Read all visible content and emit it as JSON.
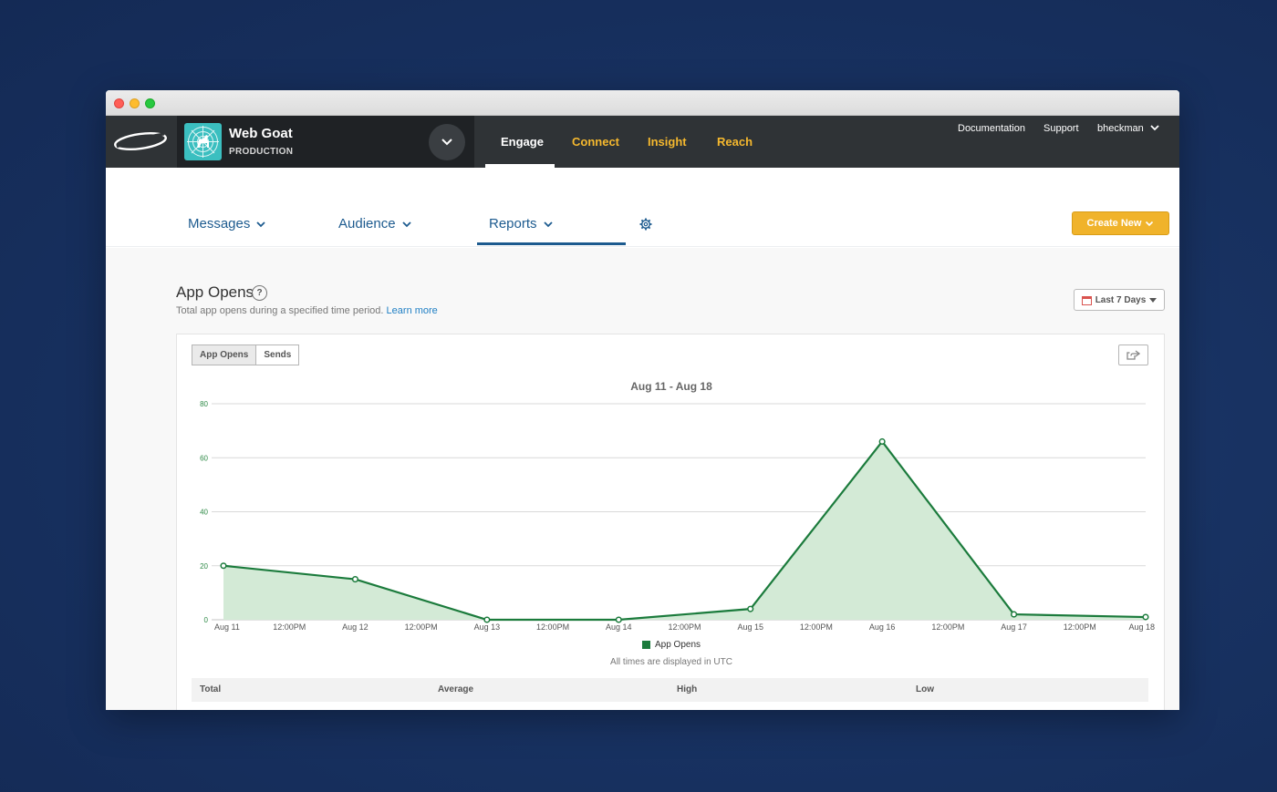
{
  "app": {
    "name": "Web Goat",
    "environment": "PRODUCTION"
  },
  "topnav": {
    "items": [
      "Engage",
      "Connect",
      "Insight",
      "Reach"
    ],
    "active": "Engage",
    "documentation": "Documentation",
    "support": "Support",
    "user": "bheckman"
  },
  "subnav": {
    "messages": "Messages",
    "audience": "Audience",
    "reports": "Reports",
    "active": "Reports",
    "create_new": "Create New"
  },
  "page": {
    "title": "App Opens",
    "help": "?",
    "description": "Total app opens during a specified time period.",
    "learn_more": "Learn more",
    "date_range": "Last 7 Days"
  },
  "card": {
    "toggles": [
      "App Opens",
      "Sends"
    ],
    "active_toggle": "App Opens",
    "utc_note": "All times are displayed in UTC",
    "stats_headers": [
      "Total",
      "Average",
      "High",
      "Low"
    ]
  },
  "colors": {
    "accent": "#f0b32b",
    "link": "#1d5b8f",
    "series": "#1b7b3c",
    "area": "#d3ead6"
  },
  "chart_data": {
    "type": "area",
    "title": "Aug 11 - Aug 18",
    "x_tick_labels": [
      "Aug 11",
      "12:00PM",
      "Aug 12",
      "12:00PM",
      "Aug 13",
      "12:00PM",
      "Aug 14",
      "12:00PM",
      "Aug 15",
      "12:00PM",
      "Aug 16",
      "12:00PM",
      "Aug 17",
      "12:00PM",
      "Aug 18"
    ],
    "y_ticks": [
      0,
      20,
      40,
      60,
      80
    ],
    "ylim": [
      0,
      80
    ],
    "grid": true,
    "legend": "bottom",
    "series": [
      {
        "name": "App Opens",
        "x": [
          "Aug 11",
          "Aug 12",
          "Aug 13",
          "Aug 14",
          "Aug 15",
          "Aug 16",
          "Aug 17",
          "Aug 18"
        ],
        "values": [
          20,
          15,
          0,
          0,
          4,
          66,
          2,
          1
        ]
      }
    ]
  }
}
